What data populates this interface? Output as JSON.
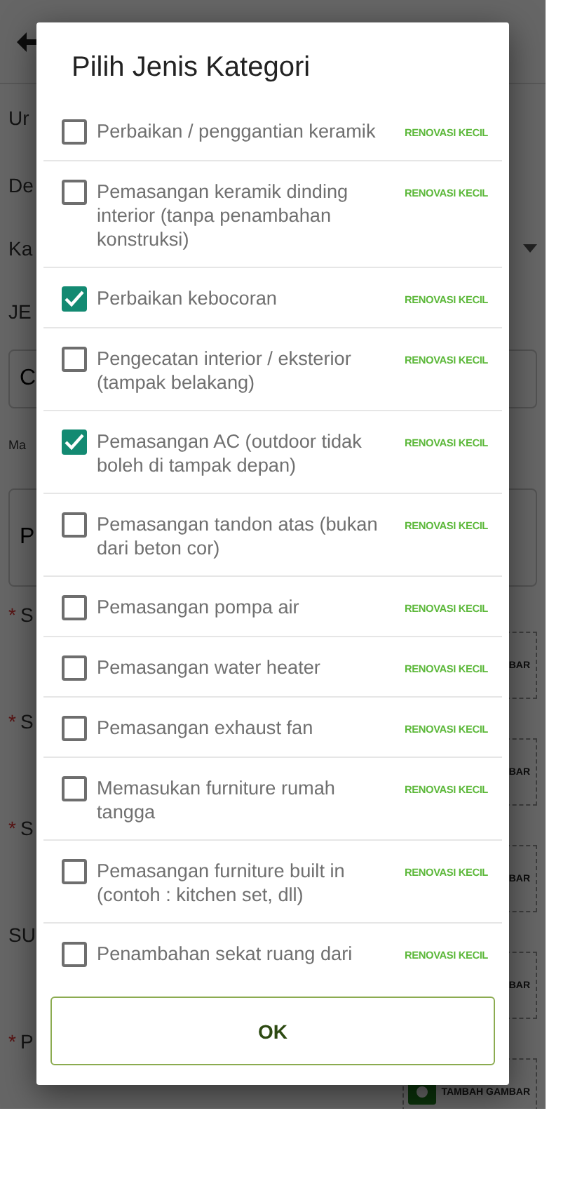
{
  "background": {
    "fields": [
      {
        "kind": "label",
        "text": "Ur"
      },
      {
        "kind": "label",
        "text": "De"
      },
      {
        "kind": "select",
        "text": "Ka"
      },
      {
        "kind": "label",
        "text": "JE"
      },
      {
        "kind": "input",
        "text": "C"
      },
      {
        "kind": "caption",
        "text": "Ma"
      },
      {
        "kind": "textarea",
        "text": "P"
      },
      {
        "kind": "upload",
        "marker": "*",
        "text": "S",
        "button": "BAR"
      },
      {
        "kind": "upload",
        "marker": "*",
        "text": "S",
        "button": "BAR"
      },
      {
        "kind": "upload",
        "marker": "*",
        "text": "S",
        "button": "BAR"
      },
      {
        "kind": "upload",
        "text": "SU",
        "button": "BAR"
      },
      {
        "kind": "upload",
        "marker": "*",
        "text": "P",
        "button": "TAMBAH GAMBAR",
        "icon": true
      }
    ]
  },
  "dialog": {
    "title": "Pilih Jenis Kategori",
    "items": [
      {
        "label": "Perbaikan / penggantian keramik",
        "tag": "RENOVASI KECIL",
        "checked": false
      },
      {
        "label": "Pemasangan keramik dinding interior (tanpa penambahan konstruksi)",
        "tag": "RENOVASI KECIL",
        "checked": false
      },
      {
        "label": "Perbaikan kebocoran",
        "tag": "RENOVASI KECIL",
        "checked": true
      },
      {
        "label": "Pengecatan interior / eksterior (tampak belakang)",
        "tag": "RENOVASI KECIL",
        "checked": false
      },
      {
        "label": "Pemasangan AC (outdoor tidak boleh di tampak depan)",
        "tag": "RENOVASI KECIL",
        "checked": true
      },
      {
        "label": "Pemasangan tandon atas (bukan dari beton cor)",
        "tag": "RENOVASI KECIL",
        "checked": false
      },
      {
        "label": "Pemasangan pompa air",
        "tag": "RENOVASI KECIL",
        "checked": false
      },
      {
        "label": "Pemasangan water heater",
        "tag": "RENOVASI KECIL",
        "checked": false
      },
      {
        "label": "Pemasangan exhaust fan",
        "tag": "RENOVASI KECIL",
        "checked": false
      },
      {
        "label": "Memasukan furniture rumah tangga",
        "tag": "RENOVASI KECIL",
        "checked": false
      },
      {
        "label": "Pemasangan furniture built in (contoh : kitchen set, dll)",
        "tag": "RENOVASI KECIL",
        "checked": false
      },
      {
        "label": "Penambahan sekat ruang dari",
        "tag": "RENOVASI KECIL",
        "checked": false
      }
    ],
    "button": "OK"
  }
}
